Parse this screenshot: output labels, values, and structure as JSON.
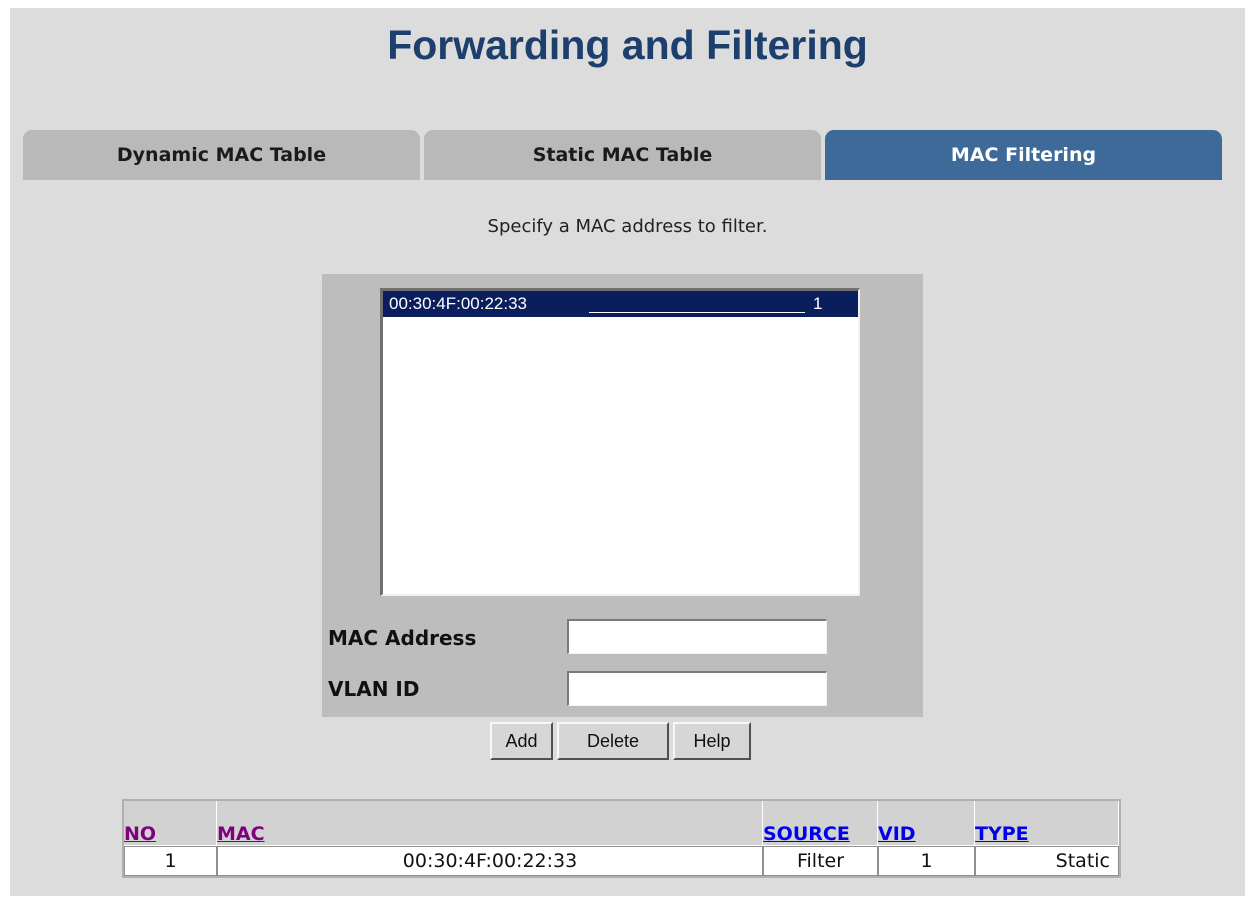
{
  "page": {
    "title": "Forwarding and Filtering"
  },
  "tabs": [
    {
      "label": "Dynamic MAC Table",
      "active": false
    },
    {
      "label": "Static MAC Table",
      "active": false
    },
    {
      "label": "MAC Filtering",
      "active": true
    }
  ],
  "instruction": "Specify a MAC address to filter.",
  "filter_list": {
    "items": [
      {
        "mac": "00:30:4F:00:22:33",
        "vid": "1",
        "selected": true
      }
    ]
  },
  "form": {
    "mac_label": "MAC Address",
    "mac_value": "",
    "vlan_label": "VLAN ID",
    "vlan_value": ""
  },
  "buttons": {
    "add": "Add",
    "delete": "Delete",
    "help": "Help"
  },
  "table": {
    "headers": {
      "no": "NO",
      "mac": "MAC",
      "source": "SOURCE",
      "vid": "VID",
      "type": "TYPE"
    },
    "rows": [
      {
        "no": "1",
        "mac": "00:30:4F:00:22:33",
        "source": "Filter",
        "vid": "1",
        "type": "Static"
      }
    ]
  },
  "colors": {
    "title": "#1d3f6e",
    "active_tab": "#3e6a9a",
    "inactive_tab": "#b9b9b9",
    "list_selection": "#0a1e5e",
    "link_visited": "#800080",
    "link_unvisited": "#0000ee"
  }
}
